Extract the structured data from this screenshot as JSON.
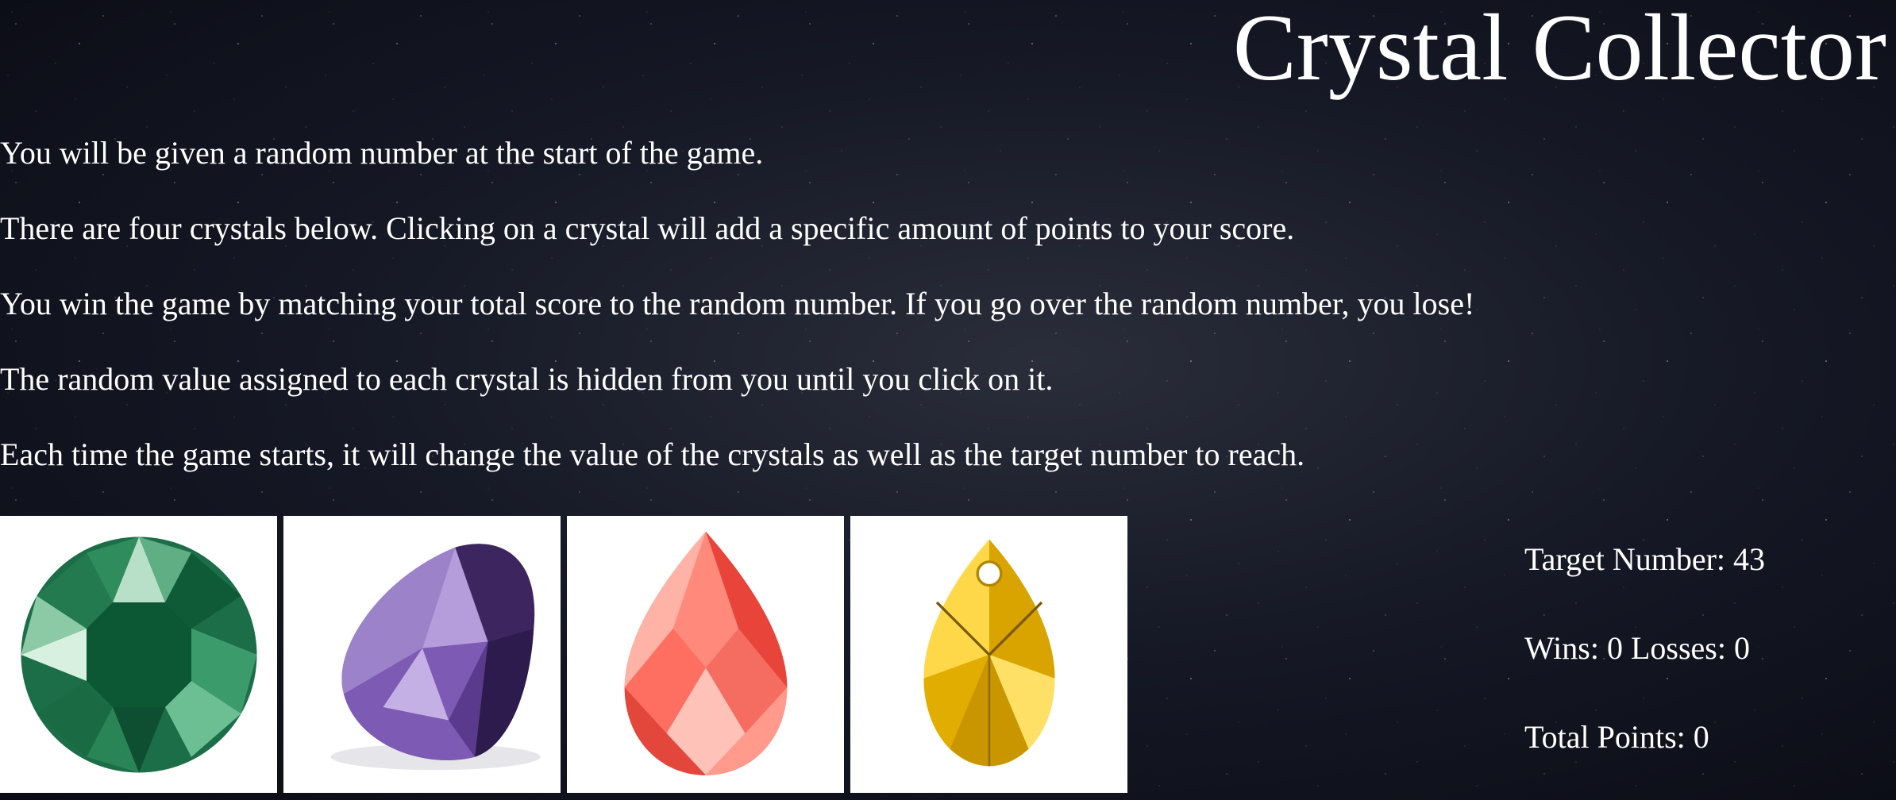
{
  "title": "Crystal Collector",
  "instructions": [
    "You will be given a random number at the start of the game.",
    "There are four crystals below. Clicking on a crystal will add a specific amount of points to your score.",
    "You win the game by matching your total score to the random number. If you go over the random number, you lose!",
    "The random value assigned to each crystal is hidden from you until you click on it.",
    "Each time the game starts, it will change the value of the crystals as well as the target number to reach."
  ],
  "crystals": [
    {
      "name": "green-round-crystal",
      "color": "#1e7a52"
    },
    {
      "name": "purple-pear-crystal",
      "color": "#7b5aa6"
    },
    {
      "name": "red-pear-crystal",
      "color": "#f2574b"
    },
    {
      "name": "yellow-pendant-crystal",
      "color": "#f2c200"
    }
  ],
  "stats": {
    "target_label": "Target Number:",
    "target_value": "43",
    "wins_label": "Wins:",
    "wins_value": "0",
    "losses_label": "Losses:",
    "losses_value": "0",
    "total_label": "Total Points:",
    "total_value": "0"
  }
}
